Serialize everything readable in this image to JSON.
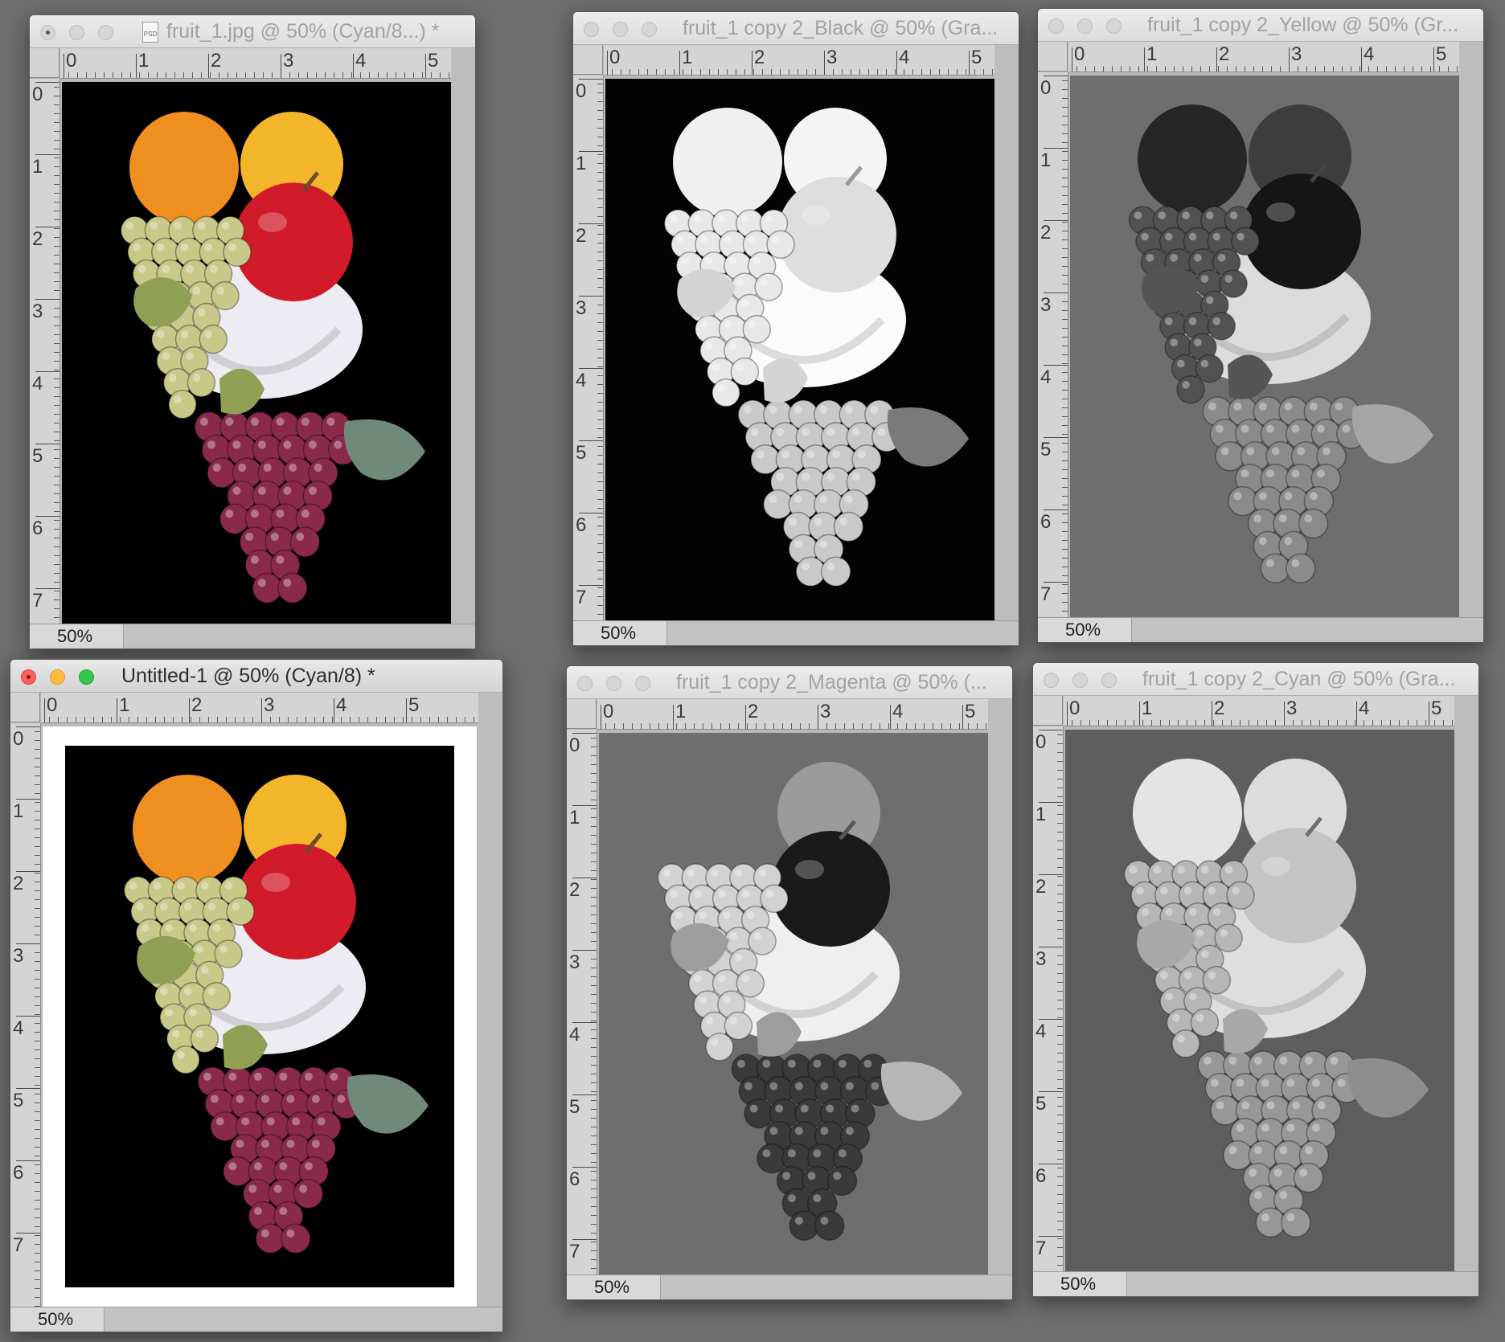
{
  "windows": [
    {
      "id": "w1",
      "title": "fruit_1.jpg @ 50% (Cyan/8...) *",
      "zoom": "50%",
      "variant": "color",
      "active": false,
      "doc_icon": true
    },
    {
      "id": "w2",
      "title": "fruit_1 copy 2_Black @ 50% (Gra...",
      "zoom": "50%",
      "variant": "black",
      "active": false,
      "doc_icon": false
    },
    {
      "id": "w3",
      "title": "fruit_1 copy 2_Yellow @ 50% (Gr...",
      "zoom": "50%",
      "variant": "yellow",
      "active": false,
      "doc_icon": false
    },
    {
      "id": "w4",
      "title": "Untitled-1 @ 50% (Cyan/8) *",
      "zoom": "50%",
      "variant": "color",
      "active": true,
      "doc_icon": false
    },
    {
      "id": "w5",
      "title": "fruit_1 copy 2_Magenta @ 50% (...",
      "zoom": "50%",
      "variant": "magenta",
      "active": false,
      "doc_icon": false
    },
    {
      "id": "w6",
      "title": "fruit_1 copy 2_Cyan @ 50% (Gra...",
      "zoom": "50%",
      "variant": "cyan",
      "active": false,
      "doc_icon": false
    }
  ],
  "ruler_numbers_h": [
    "0",
    "1",
    "2",
    "3",
    "4",
    "5"
  ],
  "ruler_numbers_v": [
    "0",
    "1",
    "2",
    "3",
    "4",
    "5",
    "6",
    "7"
  ],
  "colors": {
    "workspace": "#6e6e6e",
    "close": "#fc605b",
    "minimize": "#fdbc40",
    "zoom": "#34c84a"
  }
}
